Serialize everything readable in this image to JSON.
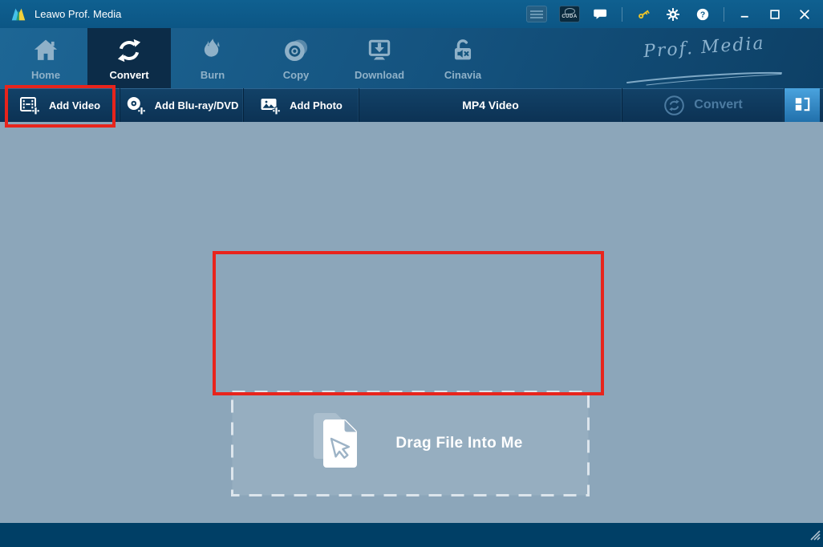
{
  "window": {
    "title": "Leawo Prof. Media"
  },
  "titlebar": {
    "cuda_badge": "CUDA",
    "icons": [
      "hardware-accel-badge",
      "cuda-badge",
      "chat-icon",
      "key-icon",
      "gear-icon",
      "help-icon",
      "minimize-icon",
      "maximize-icon",
      "close-icon"
    ]
  },
  "nav": {
    "brand": "Prof. Media",
    "tabs": [
      {
        "label": "Home",
        "icon": "home-icon",
        "active": false
      },
      {
        "label": "Convert",
        "icon": "convert-icon",
        "active": true
      },
      {
        "label": "Burn",
        "icon": "burn-icon",
        "active": false
      },
      {
        "label": "Copy",
        "icon": "copy-icon",
        "active": false
      },
      {
        "label": "Download",
        "icon": "download-icon",
        "active": false
      },
      {
        "label": "Cinavia",
        "icon": "cinavia-icon",
        "active": false
      }
    ]
  },
  "toolbar": {
    "add_video_label": "Add Video",
    "add_bluray_label": "Add Blu-ray/DVD",
    "add_photo_label": "Add Photo",
    "format_label": "MP4 Video",
    "convert_label": "Convert"
  },
  "main": {
    "drop_label": "Drag File Into Me"
  },
  "annotations": {
    "color": "#e8241c",
    "highlighted": [
      "add-video-button",
      "drop-zone"
    ]
  },
  "colors": {
    "titlebar": "#0e5c8b",
    "active_tab": "#0c2c48",
    "toolbar_bg": "#0e3c60",
    "content_bg": "#8ca6ba",
    "statusbar": "#003f66",
    "accent_button": "#2e86c8",
    "key_gold": "#edc32a"
  }
}
